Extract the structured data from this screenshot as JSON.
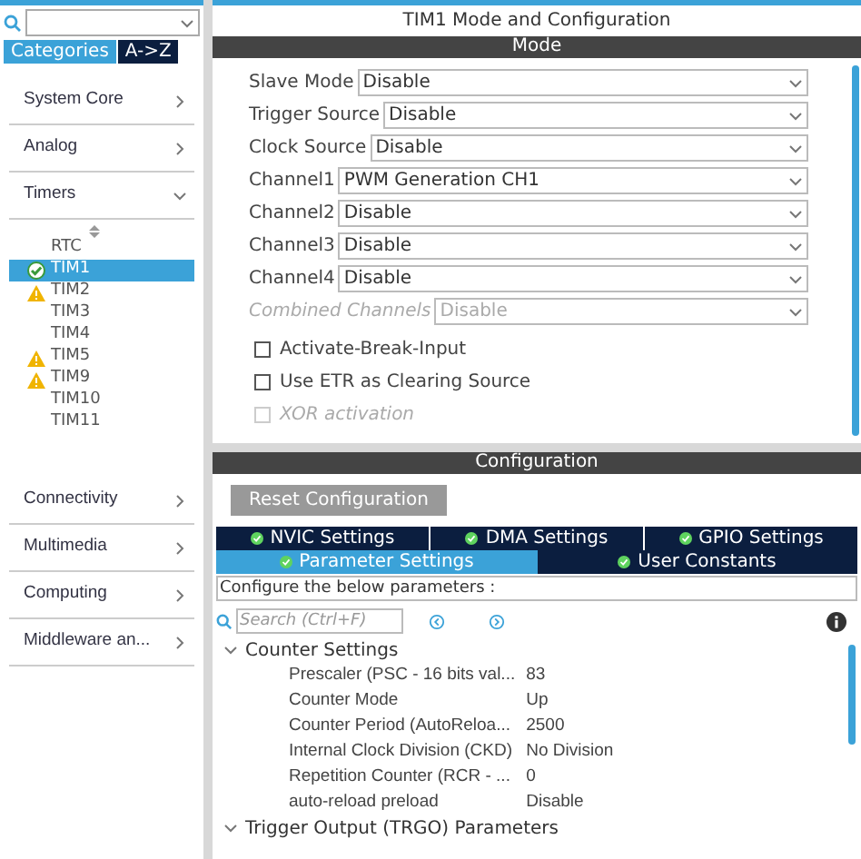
{
  "sidebar": {
    "tabs": [
      {
        "label": "Categories",
        "selected": true
      },
      {
        "label": "A->Z",
        "selected": false
      }
    ],
    "categories": [
      {
        "label": "System Core",
        "expanded": false
      },
      {
        "label": "Analog",
        "expanded": false
      },
      {
        "label": "Timers",
        "expanded": true,
        "children": [
          {
            "label": "RTC",
            "checked": false,
            "warning": false,
            "selected": false
          },
          {
            "label": "TIM1",
            "checked": true,
            "warning": false,
            "selected": true
          },
          {
            "label": "TIM2",
            "checked": false,
            "warning": true,
            "selected": false
          },
          {
            "label": "TIM3",
            "checked": false,
            "warning": false,
            "selected": false
          },
          {
            "label": "TIM4",
            "checked": false,
            "warning": false,
            "selected": false
          },
          {
            "label": "TIM5",
            "checked": false,
            "warning": true,
            "selected": false
          },
          {
            "label": "TIM9",
            "checked": false,
            "warning": true,
            "selected": false
          },
          {
            "label": "TIM10",
            "checked": false,
            "warning": false,
            "selected": false
          },
          {
            "label": "TIM11",
            "checked": false,
            "warning": false,
            "selected": false
          }
        ]
      },
      {
        "label": "Connectivity",
        "expanded": false
      },
      {
        "label": "Multimedia",
        "expanded": false
      },
      {
        "label": "Computing",
        "expanded": false
      },
      {
        "label": "Middleware an...",
        "expanded": false
      }
    ]
  },
  "window": {
    "title": "TIM1 Mode and Configuration"
  },
  "mode": {
    "header": "Mode",
    "fields": [
      {
        "label": "Slave Mode",
        "value": "Disable",
        "disabled": false
      },
      {
        "label": "Trigger Source",
        "value": "Disable",
        "disabled": false
      },
      {
        "label": "Clock Source",
        "value": "Disable",
        "disabled": false
      },
      {
        "label": "Channel1",
        "value": "PWM Generation CH1",
        "disabled": false
      },
      {
        "label": "Channel2",
        "value": "Disable",
        "disabled": false
      },
      {
        "label": "Channel3",
        "value": "Disable",
        "disabled": false
      },
      {
        "label": "Channel4",
        "value": "Disable",
        "disabled": false
      },
      {
        "label": "Combined Channels",
        "value": "Disable",
        "disabled": true
      }
    ],
    "checkboxes": [
      {
        "label": "Activate-Break-Input",
        "checked": false,
        "disabled": false
      },
      {
        "label": "Use ETR as Clearing Source",
        "checked": false,
        "disabled": false
      },
      {
        "label": "XOR activation",
        "checked": false,
        "disabled": true
      }
    ]
  },
  "configuration": {
    "header": "Configuration",
    "reset_button": "Reset Configuration",
    "tabs_row_1": [
      {
        "label": "NVIC Settings",
        "selected": false
      },
      {
        "label": "DMA Settings",
        "selected": false
      },
      {
        "label": "GPIO Settings",
        "selected": false
      }
    ],
    "tabs_row_2": [
      {
        "label": "Parameter Settings",
        "selected": true
      },
      {
        "label": "User Constants",
        "selected": false
      }
    ],
    "hint": "Configure the below parameters :",
    "search": {
      "placeholder": "Search (Ctrl+F)"
    },
    "groups": [
      {
        "label": "Counter Settings",
        "expanded": true,
        "rows": [
          {
            "name": "Prescaler (PSC - 16 bits val...",
            "value": "83"
          },
          {
            "name": "Counter Mode",
            "value": "Up"
          },
          {
            "name": "Counter Period (AutoReloa...",
            "value": "2500"
          },
          {
            "name": "Internal Clock Division (CKD)",
            "value": "No Division"
          },
          {
            "name": "Repetition Counter (RCR - ...",
            "value": "0"
          },
          {
            "name": "auto-reload preload",
            "value": "Disable"
          }
        ]
      },
      {
        "label": "Trigger Output (TRGO) Parameters",
        "expanded": true
      }
    ]
  }
}
